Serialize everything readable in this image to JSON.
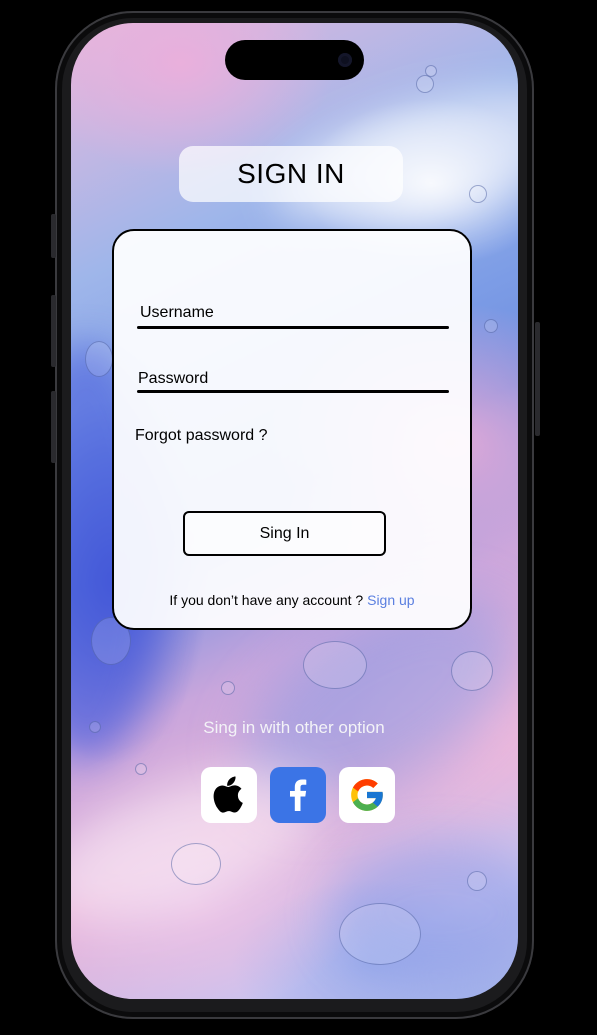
{
  "header": {
    "title": "SIGN IN"
  },
  "form": {
    "username_label": "Username",
    "password_label": "Password",
    "forgot_link": "Forgot password ?",
    "submit_label": "Sing In",
    "no_account_text": "If you don’t have any account ?",
    "signup_link": "Sign up"
  },
  "social": {
    "heading": "Sing in with other option",
    "providers": [
      {
        "name": "Apple",
        "icon": "apple-icon",
        "background": "#ffffff"
      },
      {
        "name": "Facebook",
        "icon": "facebook-icon",
        "background": "#3b74e6"
      },
      {
        "name": "Google",
        "icon": "google-icon",
        "background": "#ffffff"
      }
    ]
  },
  "colors": {
    "link": "#5a7fe0",
    "facebook": "#3b74e6"
  }
}
